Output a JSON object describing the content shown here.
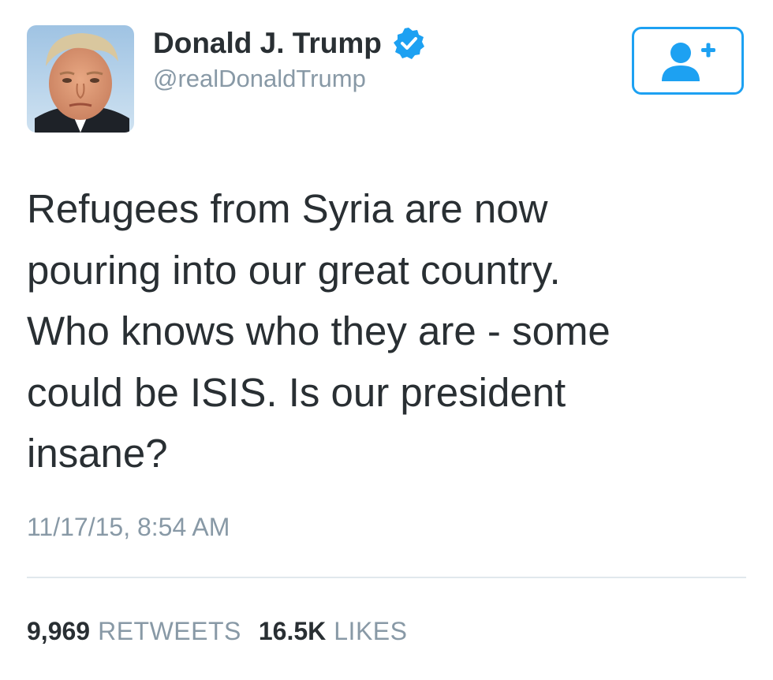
{
  "tweet": {
    "author": {
      "display_name": "Donald J. Trump",
      "handle": "@realDonaldTrump",
      "verified": true,
      "avatar_icon": "profile-photo"
    },
    "follow_button": {
      "icon": "add-user-icon",
      "color": "#1da1f2"
    },
    "text": "Refugees from Syria are now\npouring into our great country.\nWho knows who they are - some\ncould be ISIS. Is our president\ninsane?",
    "timestamp": "11/17/15, 8:54 AM",
    "stats": {
      "retweets": {
        "count": "9,969",
        "label": "RETWEETS"
      },
      "likes": {
        "count": "16.5K",
        "label": "LIKES"
      }
    }
  },
  "colors": {
    "text_primary": "#292f33",
    "text_secondary": "#8899a6",
    "accent": "#1da1f2",
    "divider": "#e1e8ed"
  }
}
